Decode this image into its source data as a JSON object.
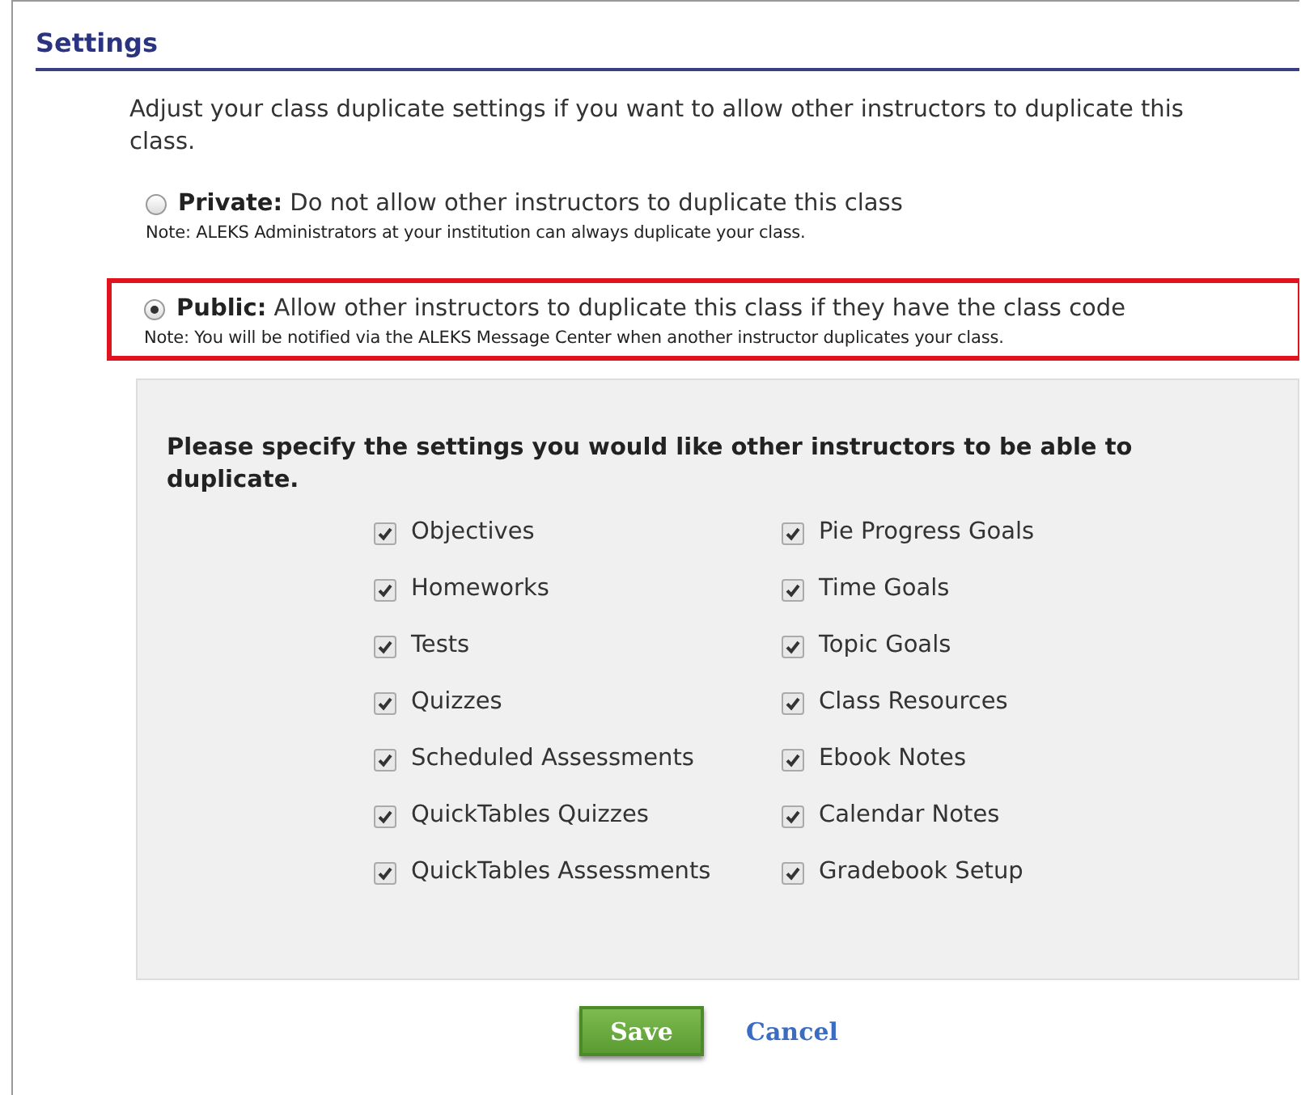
{
  "section": {
    "title": "Settings"
  },
  "intro": "Adjust your class duplicate settings if you want to allow other instructors to duplicate this class.",
  "sharing_options": [
    {
      "label": "Private:",
      "description": "Do not allow other instructors to duplicate this class",
      "note": "Note: ALEKS Administrators at your institution can always duplicate your class.",
      "selected": false,
      "highlighted": false
    },
    {
      "label": "Public:",
      "description": "Allow other instructors to duplicate this class if they have the class code",
      "note": "Note: You will be notified via the ALEKS Message Center when another instructor duplicates your class.",
      "selected": true,
      "highlighted": true
    }
  ],
  "duplicate_panel": {
    "heading": "Please specify the settings you would like other instructors to be able to duplicate.",
    "items": [
      {
        "label": "Objectives",
        "checked": true
      },
      {
        "label": "Homeworks",
        "checked": true
      },
      {
        "label": "Tests",
        "checked": true
      },
      {
        "label": "Quizzes",
        "checked": true
      },
      {
        "label": "Scheduled Assessments",
        "checked": true
      },
      {
        "label": "QuickTables Quizzes",
        "checked": true
      },
      {
        "label": "QuickTables Assessments",
        "checked": true
      },
      {
        "label": "Pie Progress Goals",
        "checked": true
      },
      {
        "label": "Time Goals",
        "checked": true
      },
      {
        "label": "Topic Goals",
        "checked": true
      },
      {
        "label": "Class Resources",
        "checked": true
      },
      {
        "label": "Ebook Notes",
        "checked": true
      },
      {
        "label": "Calendar Notes",
        "checked": true
      },
      {
        "label": "Gradebook Setup",
        "checked": true
      }
    ]
  },
  "buttons": {
    "save": "Save",
    "cancel": "Cancel"
  }
}
